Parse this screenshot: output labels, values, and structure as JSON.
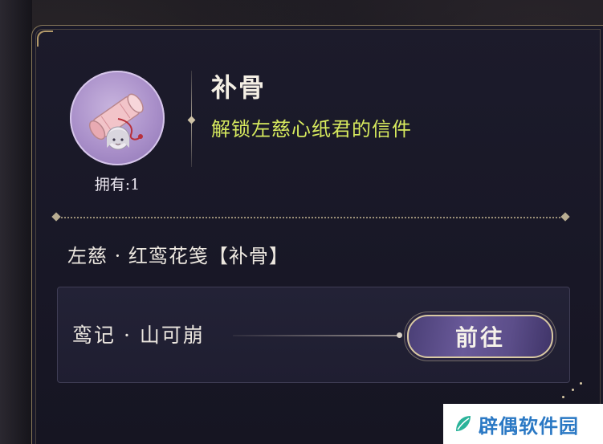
{
  "item": {
    "title": "补骨",
    "description": "解锁左慈心纸君的信件",
    "owned_label": "拥有:1",
    "icon": "scroll-letter-icon"
  },
  "source": {
    "name": "左慈 · 红鸾花笺【补骨】",
    "entry_label": "鸾记 · 山可崩",
    "go_button_label": "前往"
  },
  "watermark": {
    "text": "辟偶软件园"
  },
  "colors": {
    "accent_description": "#d7ea5e",
    "frame_gold": "#8a7a5a",
    "button_purple": "#5c4e8a",
    "avatar_lilac": "#a98fc9"
  }
}
